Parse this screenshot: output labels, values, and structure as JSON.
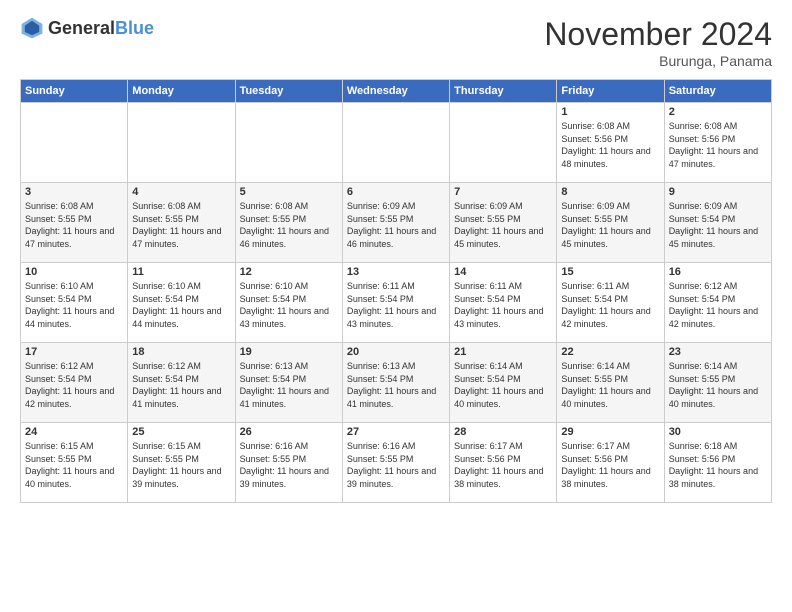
{
  "header": {
    "logo_general": "General",
    "logo_blue": "Blue",
    "month_title": "November 2024",
    "location": "Burunga, Panama"
  },
  "days_of_week": [
    "Sunday",
    "Monday",
    "Tuesday",
    "Wednesday",
    "Thursday",
    "Friday",
    "Saturday"
  ],
  "weeks": [
    [
      {
        "day": "",
        "content": ""
      },
      {
        "day": "",
        "content": ""
      },
      {
        "day": "",
        "content": ""
      },
      {
        "day": "",
        "content": ""
      },
      {
        "day": "",
        "content": ""
      },
      {
        "day": "1",
        "content": "Sunrise: 6:08 AM\nSunset: 5:56 PM\nDaylight: 11 hours and 48 minutes."
      },
      {
        "day": "2",
        "content": "Sunrise: 6:08 AM\nSunset: 5:56 PM\nDaylight: 11 hours and 47 minutes."
      }
    ],
    [
      {
        "day": "3",
        "content": "Sunrise: 6:08 AM\nSunset: 5:55 PM\nDaylight: 11 hours and 47 minutes."
      },
      {
        "day": "4",
        "content": "Sunrise: 6:08 AM\nSunset: 5:55 PM\nDaylight: 11 hours and 47 minutes."
      },
      {
        "day": "5",
        "content": "Sunrise: 6:08 AM\nSunset: 5:55 PM\nDaylight: 11 hours and 46 minutes."
      },
      {
        "day": "6",
        "content": "Sunrise: 6:09 AM\nSunset: 5:55 PM\nDaylight: 11 hours and 46 minutes."
      },
      {
        "day": "7",
        "content": "Sunrise: 6:09 AM\nSunset: 5:55 PM\nDaylight: 11 hours and 45 minutes."
      },
      {
        "day": "8",
        "content": "Sunrise: 6:09 AM\nSunset: 5:55 PM\nDaylight: 11 hours and 45 minutes."
      },
      {
        "day": "9",
        "content": "Sunrise: 6:09 AM\nSunset: 5:54 PM\nDaylight: 11 hours and 45 minutes."
      }
    ],
    [
      {
        "day": "10",
        "content": "Sunrise: 6:10 AM\nSunset: 5:54 PM\nDaylight: 11 hours and 44 minutes."
      },
      {
        "day": "11",
        "content": "Sunrise: 6:10 AM\nSunset: 5:54 PM\nDaylight: 11 hours and 44 minutes."
      },
      {
        "day": "12",
        "content": "Sunrise: 6:10 AM\nSunset: 5:54 PM\nDaylight: 11 hours and 43 minutes."
      },
      {
        "day": "13",
        "content": "Sunrise: 6:11 AM\nSunset: 5:54 PM\nDaylight: 11 hours and 43 minutes."
      },
      {
        "day": "14",
        "content": "Sunrise: 6:11 AM\nSunset: 5:54 PM\nDaylight: 11 hours and 43 minutes."
      },
      {
        "day": "15",
        "content": "Sunrise: 6:11 AM\nSunset: 5:54 PM\nDaylight: 11 hours and 42 minutes."
      },
      {
        "day": "16",
        "content": "Sunrise: 6:12 AM\nSunset: 5:54 PM\nDaylight: 11 hours and 42 minutes."
      }
    ],
    [
      {
        "day": "17",
        "content": "Sunrise: 6:12 AM\nSunset: 5:54 PM\nDaylight: 11 hours and 42 minutes."
      },
      {
        "day": "18",
        "content": "Sunrise: 6:12 AM\nSunset: 5:54 PM\nDaylight: 11 hours and 41 minutes."
      },
      {
        "day": "19",
        "content": "Sunrise: 6:13 AM\nSunset: 5:54 PM\nDaylight: 11 hours and 41 minutes."
      },
      {
        "day": "20",
        "content": "Sunrise: 6:13 AM\nSunset: 5:54 PM\nDaylight: 11 hours and 41 minutes."
      },
      {
        "day": "21",
        "content": "Sunrise: 6:14 AM\nSunset: 5:54 PM\nDaylight: 11 hours and 40 minutes."
      },
      {
        "day": "22",
        "content": "Sunrise: 6:14 AM\nSunset: 5:55 PM\nDaylight: 11 hours and 40 minutes."
      },
      {
        "day": "23",
        "content": "Sunrise: 6:14 AM\nSunset: 5:55 PM\nDaylight: 11 hours and 40 minutes."
      }
    ],
    [
      {
        "day": "24",
        "content": "Sunrise: 6:15 AM\nSunset: 5:55 PM\nDaylight: 11 hours and 40 minutes."
      },
      {
        "day": "25",
        "content": "Sunrise: 6:15 AM\nSunset: 5:55 PM\nDaylight: 11 hours and 39 minutes."
      },
      {
        "day": "26",
        "content": "Sunrise: 6:16 AM\nSunset: 5:55 PM\nDaylight: 11 hours and 39 minutes."
      },
      {
        "day": "27",
        "content": "Sunrise: 6:16 AM\nSunset: 5:55 PM\nDaylight: 11 hours and 39 minutes."
      },
      {
        "day": "28",
        "content": "Sunrise: 6:17 AM\nSunset: 5:56 PM\nDaylight: 11 hours and 38 minutes."
      },
      {
        "day": "29",
        "content": "Sunrise: 6:17 AM\nSunset: 5:56 PM\nDaylight: 11 hours and 38 minutes."
      },
      {
        "day": "30",
        "content": "Sunrise: 6:18 AM\nSunset: 5:56 PM\nDaylight: 11 hours and 38 minutes."
      }
    ]
  ]
}
